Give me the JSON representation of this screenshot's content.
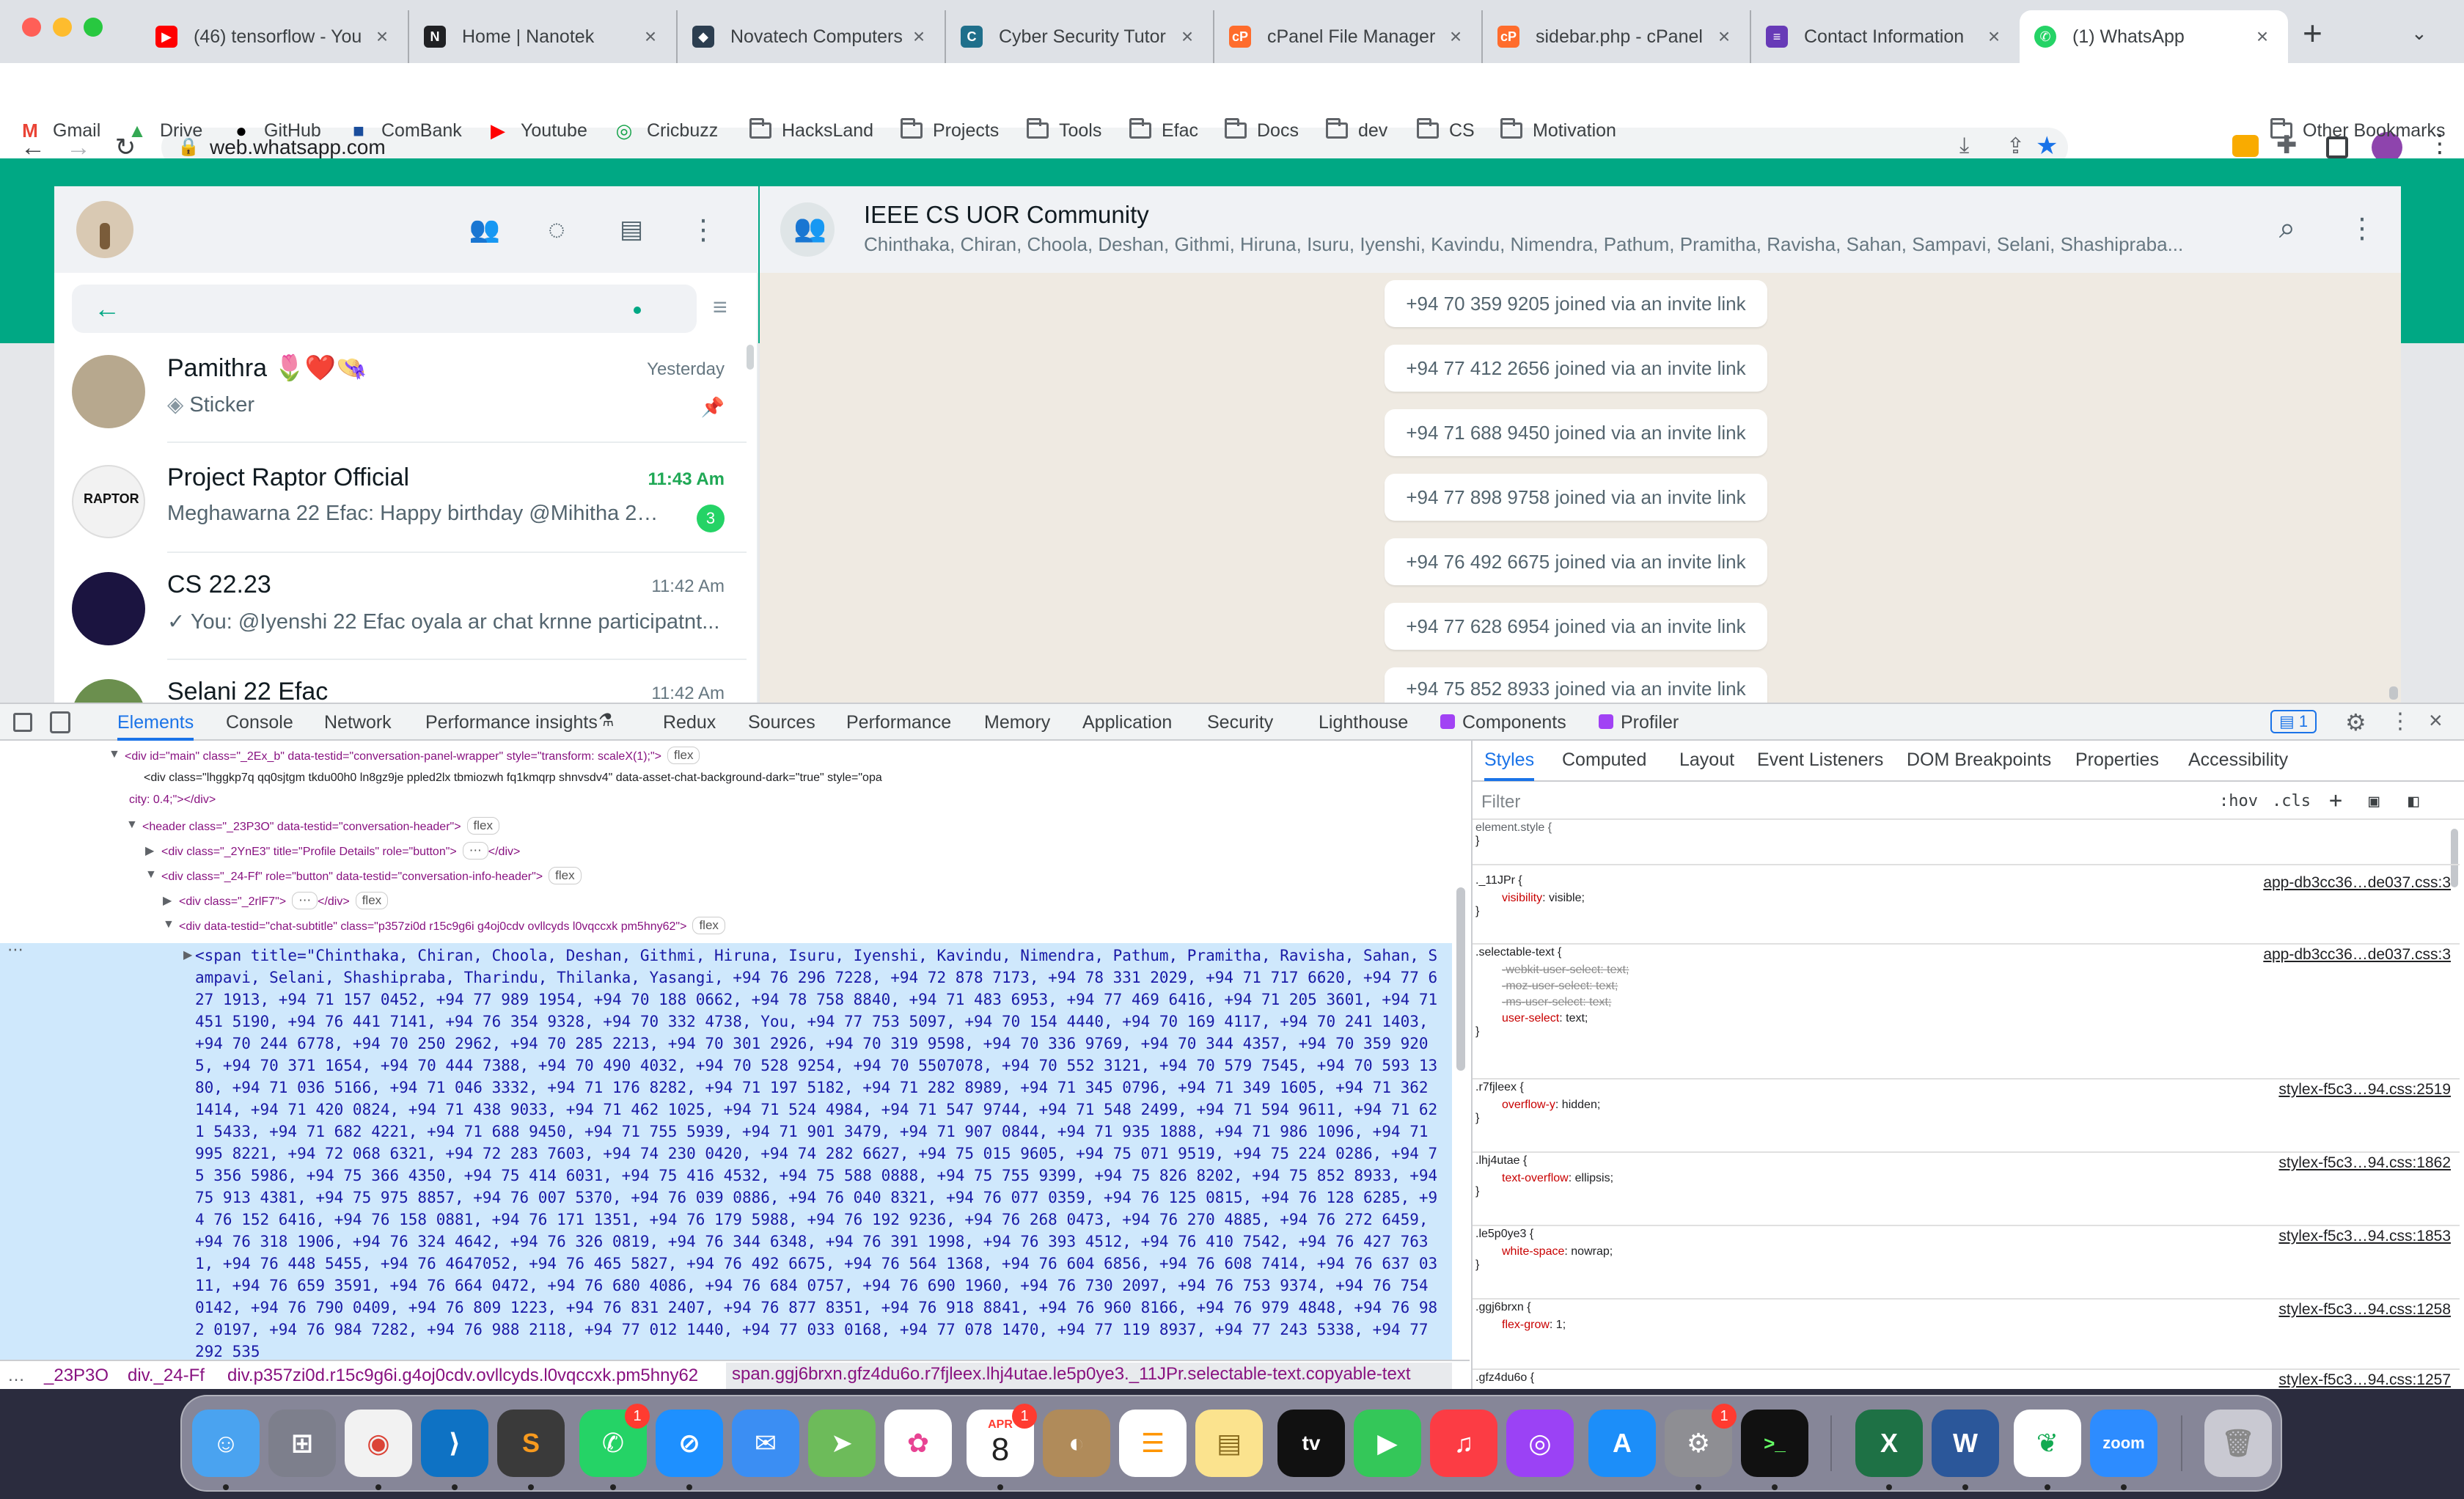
{
  "browser": {
    "tabs": [
      {
        "title": "(46) tensorflow - You",
        "icon": "youtube-icon",
        "color": "#ff0000"
      },
      {
        "title": "Home | Nanotek",
        "icon": "nanotek-icon",
        "color": "#202124"
      },
      {
        "title": "Novatech Computers",
        "icon": "novatech-icon",
        "color": "#2c3e50"
      },
      {
        "title": "Cyber Security Tutor",
        "icon": "cybersec-icon",
        "color": "#1f6f8b"
      },
      {
        "title": "cPanel File Manager",
        "icon": "cpanel-icon",
        "color": "#ff6c2c"
      },
      {
        "title": "sidebar.php - cPanel",
        "icon": "cpanel-icon",
        "color": "#ff6c2c"
      },
      {
        "title": "Contact Information",
        "icon": "form-icon",
        "color": "#673ab7"
      },
      {
        "title": "(1) WhatsApp",
        "icon": "whatsapp-icon",
        "color": "#25d366"
      }
    ],
    "new_tab": "+",
    "url": "web.whatsapp.com",
    "bookmarks": [
      {
        "label": "Gmail",
        "type": "site",
        "icon": "gmail-icon"
      },
      {
        "label": "Drive",
        "type": "site",
        "icon": "drive-icon"
      },
      {
        "label": "GitHub",
        "type": "site",
        "icon": "github-icon"
      },
      {
        "label": "ComBank",
        "type": "site",
        "icon": "combank-icon"
      },
      {
        "label": "Youtube",
        "type": "site",
        "icon": "youtube-icon"
      },
      {
        "label": "Cricbuzz",
        "type": "site",
        "icon": "cricbuzz-icon"
      },
      {
        "label": "HacksLand",
        "type": "folder"
      },
      {
        "label": "Projects",
        "type": "folder"
      },
      {
        "label": "Tools",
        "type": "folder"
      },
      {
        "label": "Efac",
        "type": "folder"
      },
      {
        "label": "Docs",
        "type": "folder"
      },
      {
        "label": "dev",
        "type": "folder"
      },
      {
        "label": "CS",
        "type": "folder"
      },
      {
        "label": "Motivation",
        "type": "folder"
      }
    ],
    "other_bookmarks": "Other Bookmarks"
  },
  "whatsapp": {
    "chats": [
      {
        "name": "Pamithra 🌷❤️👒",
        "time": "Yesterday",
        "last": "Sticker",
        "pinned": true,
        "unread": ""
      },
      {
        "name": "Project Raptor Official",
        "time": "11:43 Am",
        "last": "Meghawarna 22 Efac: Happy birthday @Mihitha 23 ...",
        "pinned": false,
        "unread": "3"
      },
      {
        "name": "CS 22.23",
        "time": "11:42 Am",
        "last": "✓ You: @Iyenshi 22 Efac oyala ar chat krnne participatnt...",
        "pinned": false,
        "unread": ""
      },
      {
        "name": "Selani 22 Efac",
        "time": "11:42 Am",
        "last": "",
        "pinned": false,
        "unread": ""
      }
    ],
    "conversation": {
      "title": "IEEE CS UOR Community",
      "members": "Chinthaka, Chiran, Choola, Deshan, Githmi, Hiruna, Isuru, Iyenshi, Kavindu, Nimendra, Pathum, Pramitha, Ravisha, Sahan, Sampavi, Selani, Shashipraba...",
      "system_messages": [
        "+94 70 359 9205 joined via an invite link",
        "+94 77 412 2656 joined via an invite link",
        "+94 71 688 9450 joined via an invite link",
        "+94 77 898 9758 joined via an invite link",
        "+94 76 492 6675 joined via an invite link",
        "+94 77 628 6954 joined via an invite link",
        "+94 75 852 8933 joined via an invite link"
      ]
    }
  },
  "devtools": {
    "tabs": [
      "Elements",
      "Console",
      "Network",
      "Performance insights",
      "Redux",
      "Sources",
      "Performance",
      "Memory",
      "Application",
      "Security",
      "Lighthouse",
      "Components",
      "Profiler"
    ],
    "issues_count": "1",
    "dom": [
      "<div id=\"main\" class=\"_2Ex_b\" data-testid=\"conversation-panel-wrapper\" style=\"transform: scaleX(1);\">",
      "<div class=\"lhggkp7q qq0sjtgm tkdu00h0 ln8gz9je ppled2lx tbmiozwh fq1kmqrp shnvsdv4\" data-asset-chat-background-dark=\"true\" style=\"opa",
      "city: 0.4;\"></div>",
      "<header class=\"_23P3O\" data-testid=\"conversation-header\">",
      "<div class=\"_2YnE3\" title=\"Profile Details\" role=\"button\">",
      "</div>",
      "<div class=\"_24-Ff\" role=\"button\" data-testid=\"conversation-info-header\">",
      "<div class=\"_2rlF7\">",
      "</div>",
      "<div data-testid=\"chat-subtitle\" class=\"p357zi0d r15c9g6i g4oj0cdv ovllcyds l0vqccxk pm5hny62\">"
    ],
    "selected_span": "<span title=\"Chinthaka, Chiran, Choola, Deshan, Githmi, Hiruna, Isuru, Iyenshi, Kavindu, Nimendra, Pathum, Pramitha, Ravisha, Sahan, Sampavi, Selani, Shashipraba, Tharindu, Thilanka, Yasangi, +94 76 296 7228, +94 72 878 7173, +94 78 331 2029, +94 71 717 6620, +94 77 627 1913, +94 71 157 0452, +94 77 989 1954, +94 70 188 0662, +94 78 758 8840, +94 71 483 6953, +94 77 469 6416, +94 71 205 3601, +94 71 451 5190, +94 76 441 7141, +94 76 354 9328, +94 70 332 4738, You, +94 77 753 5097, +94 70 154 4440, +94 70 169 4117, +94 70 241 1403, +94 70 244 6778, +94 70 250 2962, +94 70 285 2213, +94 70 301 2926, +94 70 319 9598, +94 70 336 9769, +94 70 344 4357, +94 70 359 9205, +94 70 371 1654, +94 70 444 7388, +94 70 490 4032, +94 70 528 9254, +94 70 5507078, +94 70 552 3121, +94 70 579 7545, +94 70 593 1380, +94 71 036 5166, +94 71 046 3332, +94 71 176 8282, +94 71 197 5182, +94 71 282 8989, +94 71 345 0796, +94 71 349 1605, +94 71 362 1414, +94 71 420 0824, +94 71 438 9033, +94 71 462 1025, +94 71 524 4984, +94 71 547 9744, +94 71 548 2499, +94 71 594 9611, +94 71 621 5433, +94 71 682 4221, +94 71 688 9450, +94 71 755 5939, +94 71 901 3479, +94 71 907 0844, +94 71 935 1888, +94 71 986 1096, +94 71 995 8221, +94 72 068 6321, +94 72 283 7603, +94 74 230 0420, +94 74 282 6627, +94 75 015 9605, +94 75 071 9519, +94 75 224 0286, +94 75 356 5986, +94 75 366 4350, +94 75 414 6031, +94 75 416 4532, +94 75 588 0888, +94 75 755 9399, +94 75 826 8202, +94 75 852 8933, +94 75 913 4381, +94 75 975 8857, +94 76 007 5370, +94 76 039 0886, +94 76 040 8321, +94 76 077 0359, +94 76 125 0815, +94 76 128 6285, +94 76 152 6416, +94 76 158 0881, +94 76 171 1351, +94 76 179 5988, +94 76 192 9236, +94 76 268 0473, +94 76 270 4885, +94 76 272 6459, +94 76 318 1906, +94 76 324 4642, +94 76 326 0819, +94 76 344 6348, +94 76 391 1998, +94 76 393 4512, +94 76 410 7542, +94 76 427 7631, +94 76 448 5455, +94 76 4647052, +94 76 465 5827, +94 76 492 6675, +94 76 564 1368, +94 76 604 6856, +94 76 608 7414, +94 76 637 0311, +94 76 659 3591, +94 76 664 0472, +94 76 680 4086, +94 76 684 0757, +94 76 690 1960, +94 76 730 2097, +94 76 753 9374, +94 76 754 0142, +94 76 790 0409, +94 76 809 1223, +94 76 831 2407, +94 76 877 8351, +94 76 918 8841, +94 76 960 8166, +94 76 979 4848, +94 76 982 0197, +94 76 984 7282, +94 76 988 2118, +94 77 012 1440, +94 77 033 0168, +94 77 078 1470, +94 77 119 8937, +94 77 243 5338, +94 77 292 535",
    "breadcrumbs": [
      "_23P3O",
      "div._24-Ff",
      "div.p357zi0d.r15c9g6i.g4oj0cdv.ovllcyds.l0vqccxk.pm5hny62",
      "span.ggj6brxn.gfz4du6o.r7fjleex.lhj4utae.le5p0ye3._11JPr.selectable-text.copyable-text"
    ],
    "styles_tabs": [
      "Styles",
      "Computed",
      "Layout",
      "Event Listeners",
      "DOM Breakpoints",
      "Properties",
      "Accessibility"
    ],
    "filter_placeholder": "Filter",
    "filter_tools": [
      ":hov",
      ".cls"
    ],
    "rules": [
      {
        "selector": "element.style {",
        "source": "",
        "props": []
      },
      {
        "selector": "._11JPr {",
        "source": "app-db3cc36…de037.css:3",
        "props": [
          {
            "n": "visibility",
            "v": "visible;",
            "s": false
          }
        ]
      },
      {
        "selector": ".selectable-text {",
        "source": "app-db3cc36…de037.css:3",
        "props": [
          {
            "n": "-webkit-user-select",
            "v": "text;",
            "s": true
          },
          {
            "n": "-moz-user-select",
            "v": "text;",
            "s": true
          },
          {
            "n": "-ms-user-select",
            "v": "text;",
            "s": true
          },
          {
            "n": "user-select",
            "v": "text;",
            "s": false
          }
        ]
      },
      {
        "selector": ".r7fjleex {",
        "source": "stylex-f5c3…94.css:2519",
        "props": [
          {
            "n": "overflow-y",
            "v": "hidden;",
            "s": false
          }
        ]
      },
      {
        "selector": ".lhj4utae {",
        "source": "stylex-f5c3…94.css:1862",
        "props": [
          {
            "n": "text-overflow",
            "v": "ellipsis;",
            "s": false
          }
        ]
      },
      {
        "selector": ".le5p0ye3 {",
        "source": "stylex-f5c3…94.css:1853",
        "props": [
          {
            "n": "white-space",
            "v": "nowrap;",
            "s": false
          }
        ]
      },
      {
        "selector": ".ggj6brxn {",
        "source": "stylex-f5c3…94.css:1258",
        "props": [
          {
            "n": "flex-grow",
            "v": "1;",
            "s": false
          }
        ]
      },
      {
        "selector": ".gfz4du6o {",
        "source": "stylex-f5c3…94.css:1257",
        "props": []
      }
    ]
  },
  "dock": {
    "calendar_month": "APR",
    "calendar_day": "8"
  }
}
